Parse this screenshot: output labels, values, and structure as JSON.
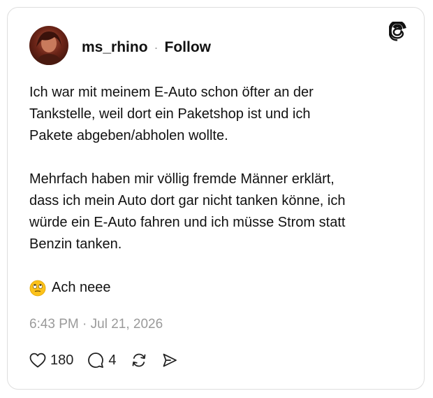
{
  "post": {
    "username": "ms_rhino",
    "separator": "·",
    "follow_label": "Follow",
    "body_lines_p1": [
      "Ich war mit meinem E-Auto schon öfter an der",
      "Tankstelle, weil dort ein Paketshop ist und ich",
      "Pakete abgeben/abholen wollte."
    ],
    "body_lines_p2": [
      "Mehrfach haben mir völlig fremde Männer erklärt,",
      "dass ich mein Auto dort gar nicht tanken könne, ich",
      "würde ein E-Auto fahren und ich müsse Strom statt",
      "Benzin tanken."
    ],
    "emoji_icon": "eye-roll-emoji-icon",
    "closing_text": "Ach neee",
    "timestamp": "6:43 PM · Jul 21, 2026",
    "likes": "180",
    "replies": "4"
  },
  "icons": {
    "brand": "threads-logo-icon",
    "like": "heart-icon",
    "reply": "comment-icon",
    "repost": "repost-icon",
    "share": "send-icon"
  },
  "colors": {
    "text": "#111111",
    "muted": "#9a9a9a",
    "border": "#dedede"
  }
}
